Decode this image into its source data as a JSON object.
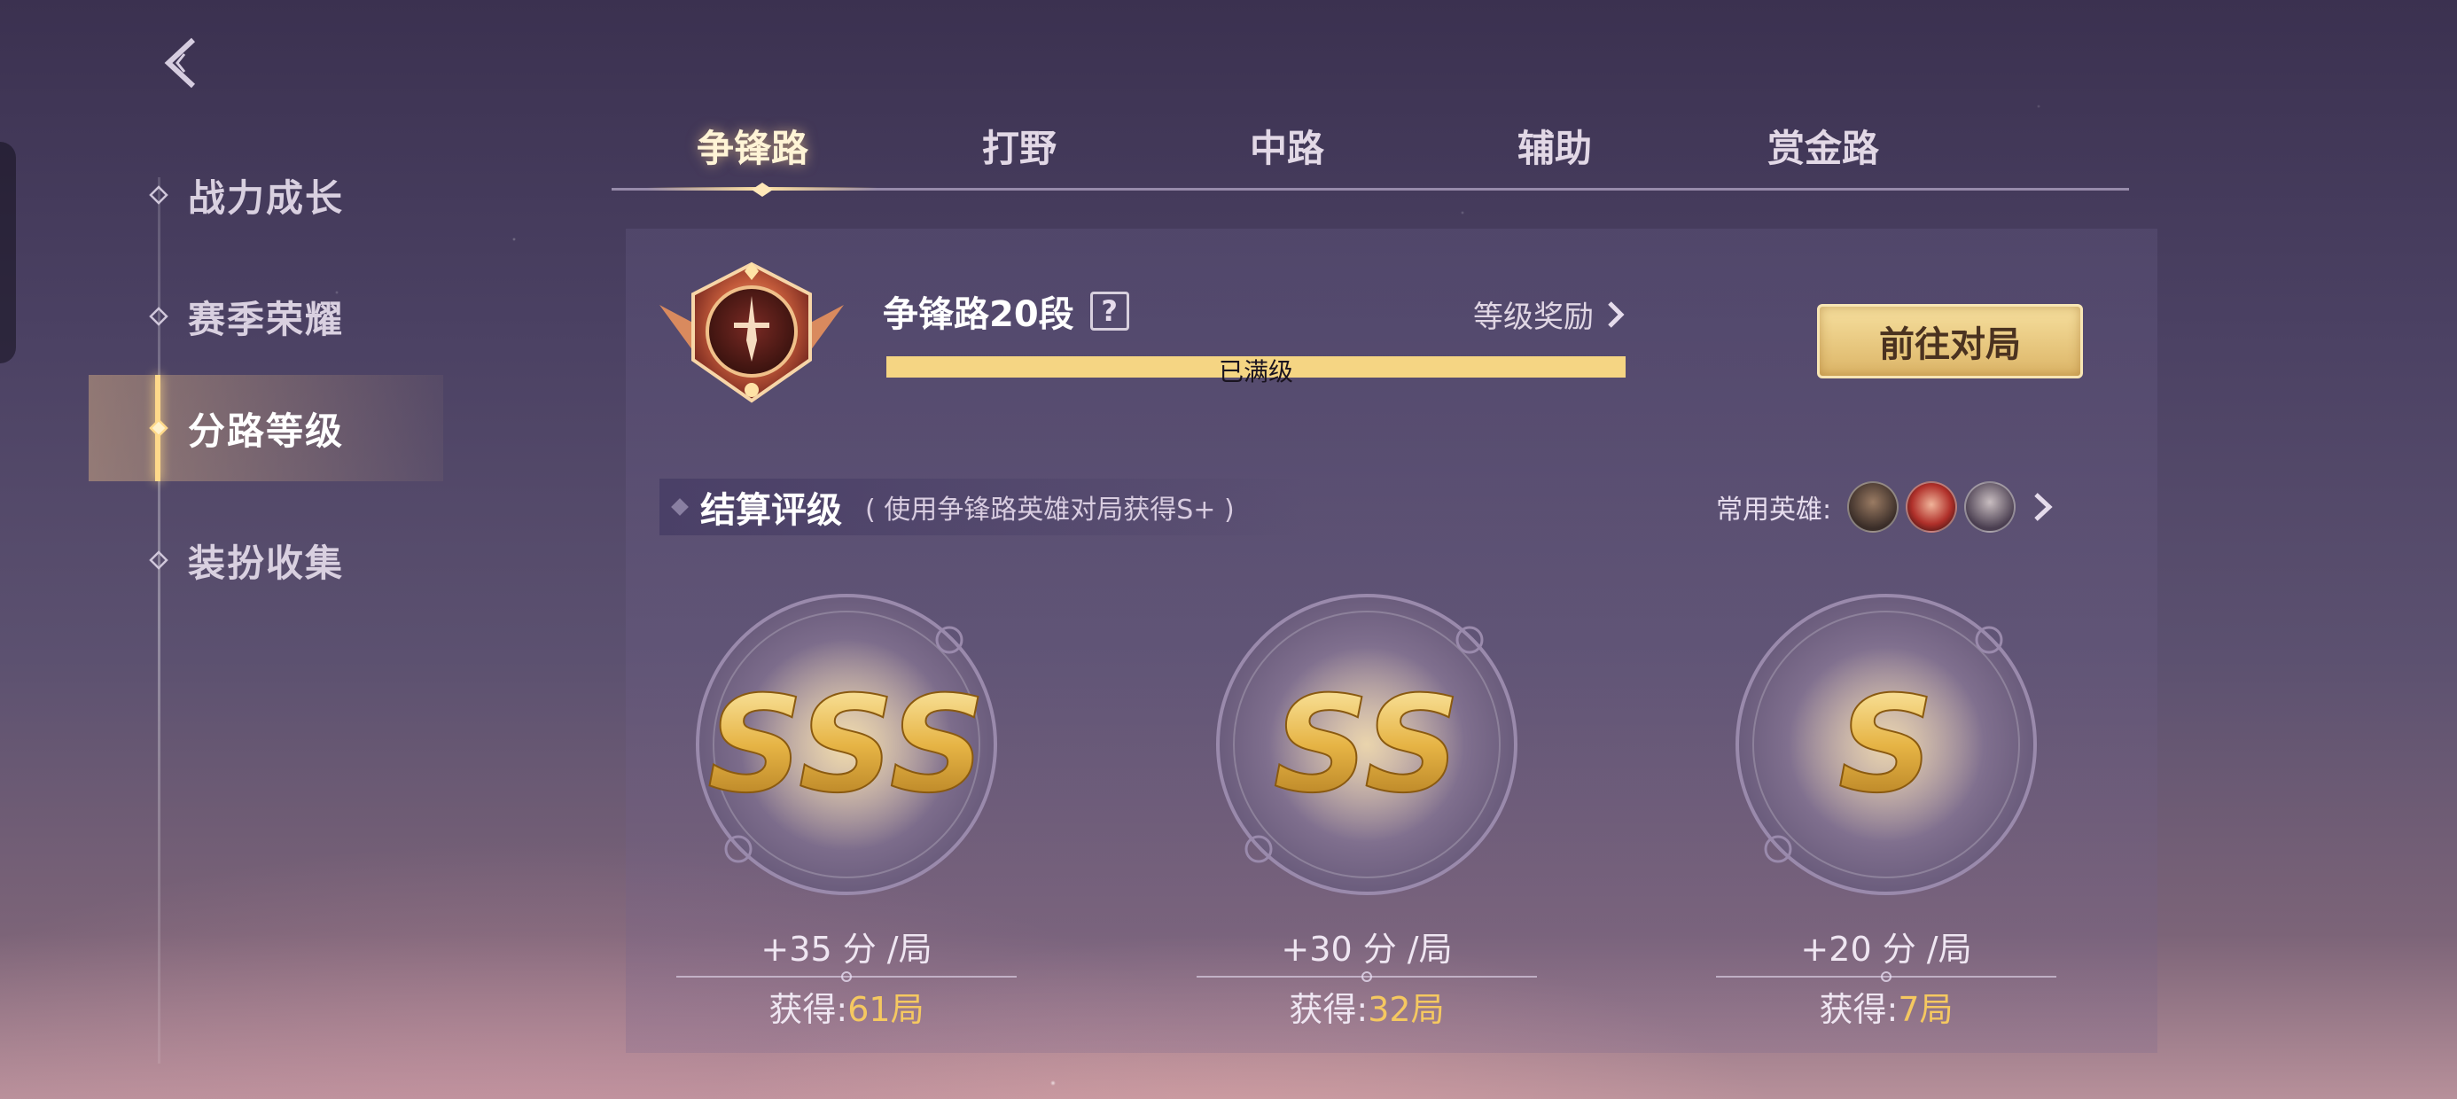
{
  "sidebar": {
    "items": [
      {
        "label": "战力成长"
      },
      {
        "label": "赛季荣耀"
      },
      {
        "label": "分路等级"
      },
      {
        "label": "装扮收集"
      }
    ]
  },
  "tabs": [
    {
      "label": "争锋路"
    },
    {
      "label": "打野"
    },
    {
      "label": "中路"
    },
    {
      "label": "辅助"
    },
    {
      "label": "赏金路"
    }
  ],
  "lane": {
    "title": "争锋路20段",
    "help": "?",
    "reward_link": "等级奖励",
    "progress_text": "已满级",
    "progress": 1.0,
    "go_button": "前往对局"
  },
  "rating": {
    "title": "结算评级",
    "subtitle": "( 使用争锋路英雄对局获得S+ )",
    "heroes_label": "常用英雄:",
    "grades": [
      {
        "grade": "SSS",
        "score": "+35 分 /局",
        "earned_label": "获得:",
        "earned_value": "61局"
      },
      {
        "grade": "SS",
        "score": "+30 分 /局",
        "earned_label": "获得:",
        "earned_value": "32局"
      },
      {
        "grade": "S",
        "score": "+20 分 /局",
        "earned_label": "获得:",
        "earned_value": "7局"
      }
    ]
  },
  "colors": {
    "accent_gold": "#f5c860",
    "progress_fill": "#f5d583",
    "button_gold": "#dcb567"
  }
}
